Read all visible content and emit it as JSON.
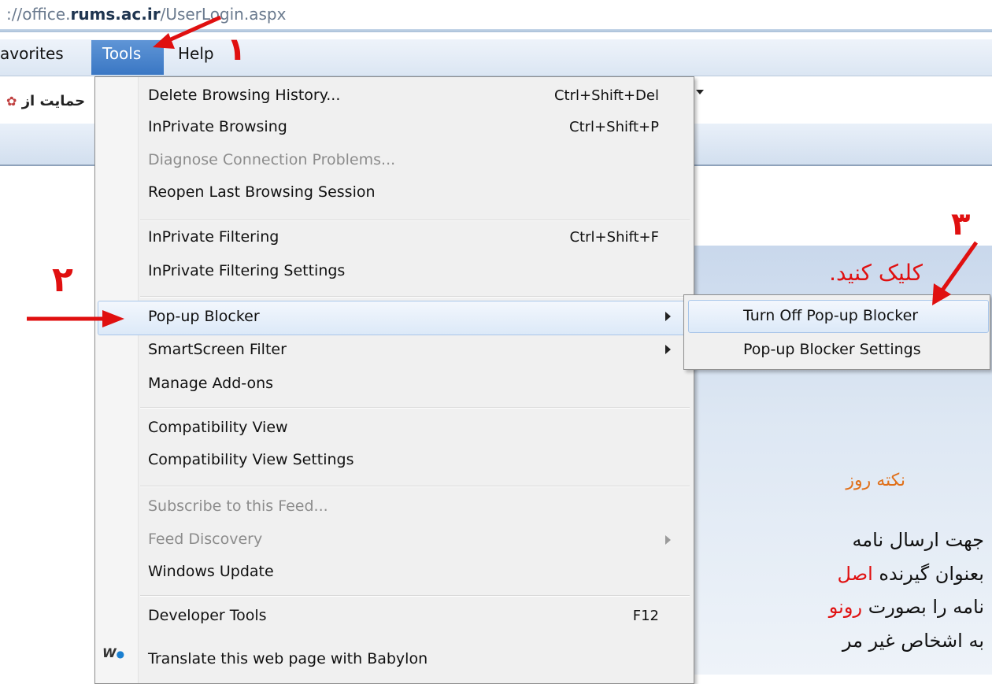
{
  "address_bar": {
    "url_prefix": "://office.",
    "url_domain": "rums.ac.ir",
    "url_path": "/UserLogin.aspx"
  },
  "menubar": {
    "items": [
      {
        "label": "avorites"
      },
      {
        "label": "Tools"
      },
      {
        "label": "Help"
      }
    ]
  },
  "toolbar": {
    "rtl_text": "حمایت از"
  },
  "tools_menu": {
    "items": [
      {
        "label": "Delete Browsing History...",
        "shortcut": "Ctrl+Shift+Del",
        "enabled": true
      },
      {
        "label": "InPrivate Browsing",
        "shortcut": "Ctrl+Shift+P",
        "enabled": true
      },
      {
        "label": "Diagnose Connection Problems...",
        "shortcut": "",
        "enabled": false
      },
      {
        "label": "Reopen Last Browsing Session",
        "shortcut": "",
        "enabled": true
      },
      {
        "label": "InPrivate Filtering",
        "shortcut": "Ctrl+Shift+F",
        "enabled": true
      },
      {
        "label": "InPrivate Filtering Settings",
        "shortcut": "",
        "enabled": true
      },
      {
        "label": "Pop-up Blocker",
        "shortcut": "",
        "enabled": true,
        "submenu": true,
        "highlighted": true
      },
      {
        "label": "SmartScreen Filter",
        "shortcut": "",
        "enabled": true,
        "submenu": true
      },
      {
        "label": "Manage Add-ons",
        "shortcut": "",
        "enabled": true
      },
      {
        "label": "Compatibility View",
        "shortcut": "",
        "enabled": true
      },
      {
        "label": "Compatibility View Settings",
        "shortcut": "",
        "enabled": true
      },
      {
        "label": "Subscribe to this Feed...",
        "shortcut": "",
        "enabled": false
      },
      {
        "label": "Feed Discovery",
        "shortcut": "",
        "enabled": false,
        "submenu": true
      },
      {
        "label": "Windows Update",
        "shortcut": "",
        "enabled": true
      },
      {
        "label": "Developer Tools",
        "shortcut": "F12",
        "enabled": true
      },
      {
        "label": "Translate this web page with Babylon",
        "shortcut": "",
        "enabled": true,
        "icon": "babylon-icon"
      }
    ]
  },
  "popup_submenu": {
    "items": [
      {
        "label": "Turn Off Pop-up Blocker",
        "highlighted": true
      },
      {
        "label": "Pop-up Blocker Settings"
      }
    ]
  },
  "annotations": {
    "step1": "١",
    "step2": "٢",
    "step3": "٣",
    "click_text": "کلیک کنید.",
    "color": "#e01010"
  },
  "page_content": {
    "tip_title": "نکته روز",
    "lines": [
      {
        "text": "جهت ارسال نامه",
        "red": ""
      },
      {
        "text": "بعنوان گیرنده",
        "red": "اصل"
      },
      {
        "text": "نامه را بصورت",
        "red": "رونو"
      },
      {
        "text": "به اشخاص غیر مر",
        "red": ""
      }
    ]
  }
}
